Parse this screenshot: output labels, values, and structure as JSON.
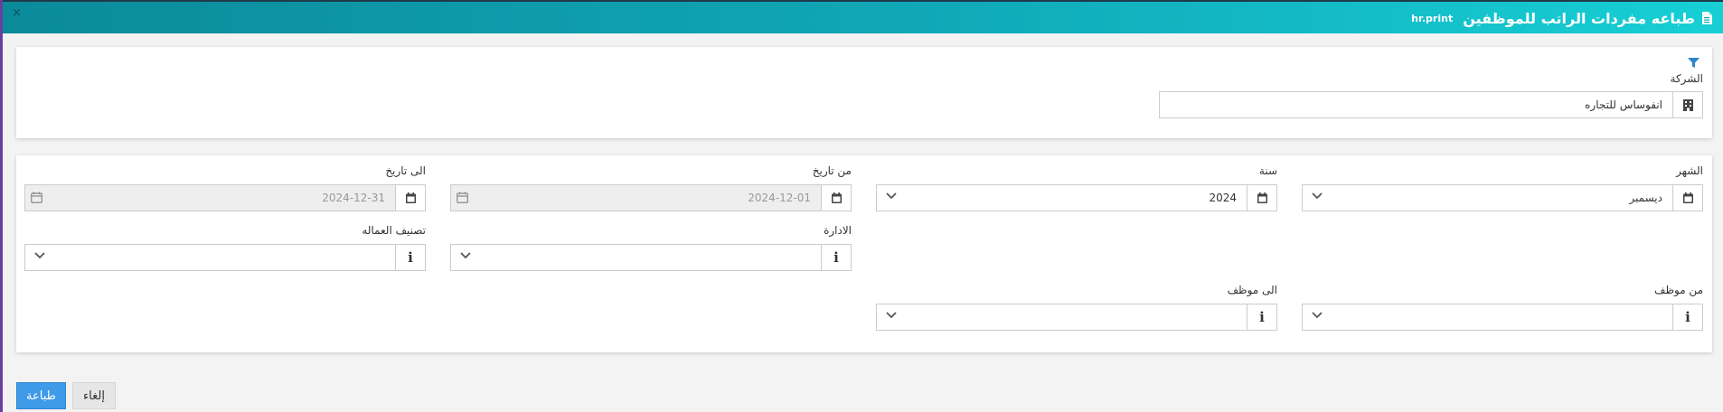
{
  "window": {
    "title": "طباعه مفردات الراتب للموظفين",
    "code": "hr.print",
    "close_glyph": "×"
  },
  "company_section": {
    "label": "الشركة",
    "value": "انفوساس للتجاره"
  },
  "filters": {
    "month": {
      "label": "الشهر",
      "value": "ديسمبر"
    },
    "year": {
      "label": "سنة",
      "value": "2024"
    },
    "from_date": {
      "label": "من تاريخ",
      "value": "2024-12-01"
    },
    "to_date": {
      "label": "الى تاريخ",
      "value": "2024-12-31"
    },
    "department": {
      "label": "الادارة",
      "value": ""
    },
    "worker_class": {
      "label": "تصنيف العماله",
      "value": ""
    },
    "from_employee": {
      "label": "من موظف",
      "value": ""
    },
    "to_employee": {
      "label": "الى موظف",
      "value": ""
    }
  },
  "icons": {
    "close": "close-icon",
    "document": "document-icon",
    "filter": "filter-icon",
    "building": "building-icon",
    "calendar": "calendar-icon",
    "info": "info-icon",
    "chevron": "chevron-down-icon",
    "info_glyph": "i"
  },
  "buttons": {
    "print": "طباعة",
    "cancel": "إلغاء"
  },
  "colors": {
    "header_start": "#0b8a9a",
    "header_end": "#17cfd5",
    "primary_button": "#3f9ae8",
    "filter_icon": "#2a86c8",
    "left_accent": "#6a3ea1"
  }
}
